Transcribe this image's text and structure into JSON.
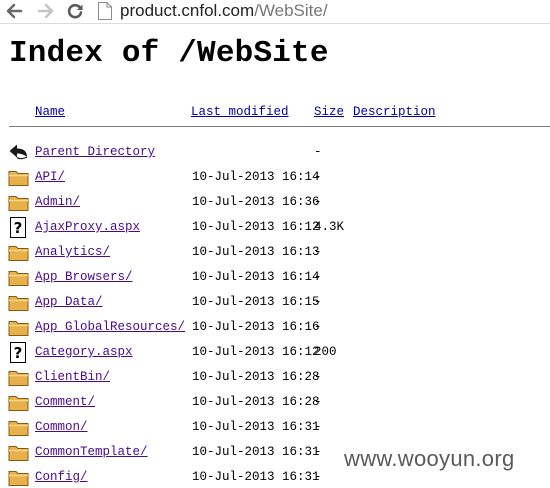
{
  "browser": {
    "url_host": "product.cnfol.com",
    "url_path": "/WebSite/"
  },
  "page": {
    "title": "Index of /WebSite",
    "columns": {
      "name": "Name",
      "last_modified": "Last modified",
      "size": "Size",
      "description": "Description"
    },
    "entries": [
      {
        "name": "Parent Directory",
        "date": "",
        "size": "-",
        "icon": "back-arrow-icon"
      },
      {
        "name": "API/",
        "date": "10-Jul-2013 16:14",
        "size": "-",
        "icon": "folder-icon"
      },
      {
        "name": "Admin/",
        "date": "10-Jul-2013 16:36",
        "size": "-",
        "icon": "folder-icon"
      },
      {
        "name": "AjaxProxy.aspx",
        "date": "10-Jul-2013 16:12",
        "size": "4.3K",
        "icon": "unknown-file-icon"
      },
      {
        "name": "Analytics/",
        "date": "10-Jul-2013 16:13",
        "size": "-",
        "icon": "folder-icon"
      },
      {
        "name": "App_Browsers/",
        "date": "10-Jul-2013 16:14",
        "size": "-",
        "icon": "folder-icon"
      },
      {
        "name": "App_Data/",
        "date": "10-Jul-2013 16:15",
        "size": "-",
        "icon": "folder-icon"
      },
      {
        "name": "App_GlobalResources/",
        "date": "10-Jul-2013 16:16",
        "size": "-",
        "icon": "folder-icon"
      },
      {
        "name": "Category.aspx",
        "date": "10-Jul-2013 16:12",
        "size": "200",
        "icon": "unknown-file-icon"
      },
      {
        "name": "ClientBin/",
        "date": "10-Jul-2013 16:28",
        "size": "-",
        "icon": "folder-icon"
      },
      {
        "name": "Comment/",
        "date": "10-Jul-2013 16:28",
        "size": "-",
        "icon": "folder-icon"
      },
      {
        "name": "Common/",
        "date": "10-Jul-2013 16:31",
        "size": "-",
        "icon": "folder-icon"
      },
      {
        "name": "CommonTemplate/",
        "date": "10-Jul-2013 16:31",
        "size": "-",
        "icon": "folder-icon"
      },
      {
        "name": "Config/",
        "date": "10-Jul-2013 16:31",
        "size": "-",
        "icon": "folder-icon"
      }
    ]
  },
  "watermark": "www.wooyun.org",
  "colors": {
    "link": "#4a0a8c",
    "header_link": "#00009c",
    "folder": "#e8b04a"
  }
}
